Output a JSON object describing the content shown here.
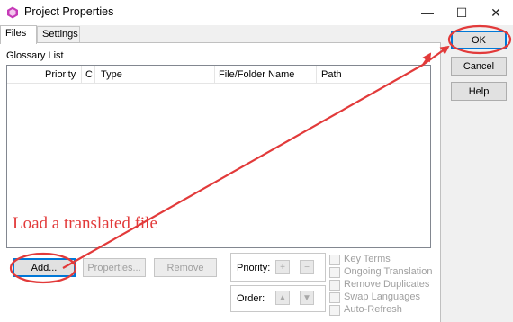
{
  "window": {
    "title": "Project Properties",
    "controls": {
      "minimize": "—",
      "maximize": "☐",
      "close": "✕"
    }
  },
  "tabs": [
    {
      "label": "Files",
      "active": true
    },
    {
      "label": "Settings",
      "active": false
    }
  ],
  "glossary": {
    "group_label": "Glossary List",
    "columns": [
      "Priority",
      "C",
      "Type",
      "File/Folder Name",
      "Path"
    ]
  },
  "buttons": {
    "add": "Add...",
    "properties": "Properties...",
    "remove": "Remove",
    "ok": "OK",
    "cancel": "Cancel",
    "help": "Help"
  },
  "priority": {
    "label": "Priority:",
    "up": "+",
    "down": "−"
  },
  "order": {
    "label": "Order:",
    "up": "▲",
    "down": "▼"
  },
  "options": [
    {
      "label": "Key Terms",
      "checked": false
    },
    {
      "label": "Ongoing Translation",
      "checked": false
    },
    {
      "label": "Remove Duplicates",
      "checked": false
    },
    {
      "label": "Swap Languages",
      "checked": false
    },
    {
      "label": "Auto-Refresh",
      "checked": false
    }
  ],
  "annotation": {
    "text": "Load a translated file",
    "color": "#e23a3a"
  },
  "colors": {
    "accent": "#0078d7",
    "annotation_red": "#e23a3a",
    "app_icon": "#c63ab8"
  }
}
